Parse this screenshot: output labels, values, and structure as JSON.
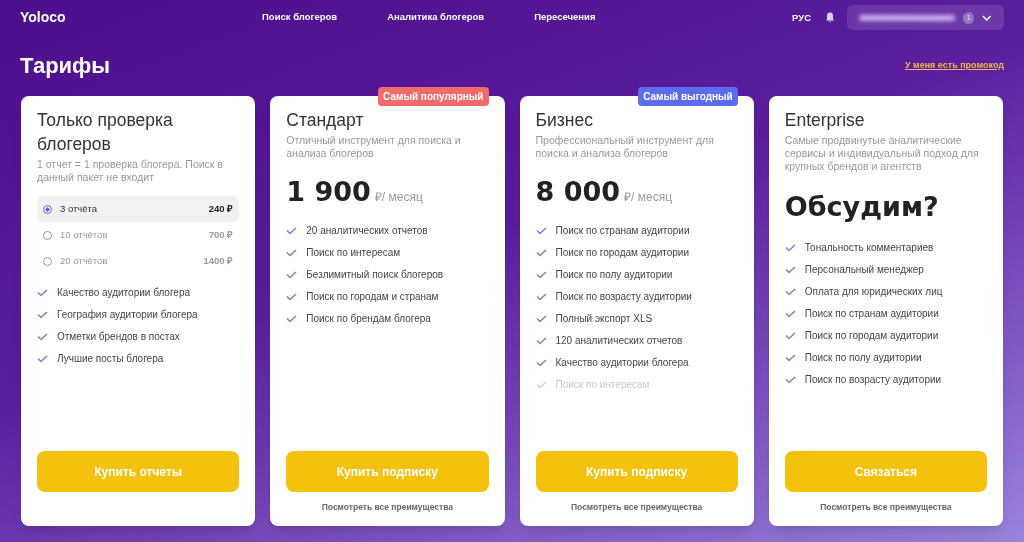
{
  "header": {
    "logo": "Yoloco",
    "nav": [
      {
        "label": "Поиск блогеров"
      },
      {
        "label": "Аналитика блогеров"
      },
      {
        "label": "Пересечения"
      }
    ],
    "language": "РУС",
    "account": {
      "badge": "1"
    }
  },
  "page": {
    "title": "Тарифы",
    "promo_link": "У меня есть промокод"
  },
  "plans": [
    {
      "kind": "options",
      "title": "Только проверка блогеров",
      "description": "1 отчет = 1 проверка блогера. Поиск в данный пакет не входит",
      "options": [
        {
          "label": "3 отчёта",
          "price": "240 ₽",
          "selected": true
        },
        {
          "label": "10 отчётов",
          "price": "700 ₽",
          "selected": false
        },
        {
          "label": "20 отчётов",
          "price": "1400 ₽",
          "selected": false
        }
      ],
      "features": [
        {
          "text": "Качество аудитории блогера",
          "faded": false
        },
        {
          "text": "География аудитории блогера",
          "faded": false
        },
        {
          "text": "Отметки брендов в постах",
          "faded": false
        },
        {
          "text": "Лучшие посты блогера",
          "faded": false
        }
      ],
      "button": "Купить отчеты"
    },
    {
      "kind": "price",
      "badge": {
        "text": "Самый популярный",
        "color": "#f26b6b"
      },
      "title": "Стандарт",
      "description": "Отличный инструмент для поиска и анализа блогеров",
      "price": "1 900",
      "unit": "₽/ месяц",
      "features": [
        {
          "text": "20 аналитических отчетов",
          "faded": false
        },
        {
          "text": "Поиск по интересам",
          "faded": false
        },
        {
          "text": "Безлимитный поиск блогеров",
          "faded": false
        },
        {
          "text": "Поиск по городам и странам",
          "faded": false
        },
        {
          "text": "Поиск по брендам блогера",
          "faded": false
        }
      ],
      "button": "Купить подписку",
      "more_link": "Посмотреть все преимущества"
    },
    {
      "kind": "price",
      "badge": {
        "text": "Самый выгодный",
        "color": "#5b6cf0"
      },
      "title": "Бизнес",
      "description": "Профессиональный инструмент для поиска и анализа блогеров",
      "price": "8 000",
      "unit": "₽/ месяц",
      "features": [
        {
          "text": "Поиск по странам аудитории",
          "faded": false
        },
        {
          "text": "Поиск по городам аудитории",
          "faded": false
        },
        {
          "text": "Поиск по полу аудитории",
          "faded": false
        },
        {
          "text": "Поиск по возрасту аудитории",
          "faded": false
        },
        {
          "text": "Полный экспорт XLS",
          "faded": false
        },
        {
          "text": "120 аналитических отчетов",
          "faded": false
        },
        {
          "text": "Качество аудитории блогера",
          "faded": false
        },
        {
          "text": "Поиск по интересам",
          "faded": true
        }
      ],
      "button": "Купить подписку",
      "more_link": "Посмотреть все преимущества"
    },
    {
      "kind": "contact",
      "title": "Enterprise",
      "description": "Самые продвинутые аналитические сервисы и индивидуальный подход для крупных брендов и агентств",
      "headline": "Обсудим?",
      "features": [
        {
          "text": "Тональность комментариев",
          "faded": false
        },
        {
          "text": "Персональный менеджер",
          "faded": false
        },
        {
          "text": "Оплата для юридических лиц",
          "faded": false
        },
        {
          "text": "Поиск по странам аудитории",
          "faded": false
        },
        {
          "text": "Поиск по городам аудитории",
          "faded": false
        },
        {
          "text": "Поиск по полу аудитории",
          "faded": false
        },
        {
          "text": "Поиск по возрасту аудитории",
          "faded": false
        }
      ],
      "button": "Связаться",
      "more_link": "Посмотреть все преимущества"
    }
  ]
}
